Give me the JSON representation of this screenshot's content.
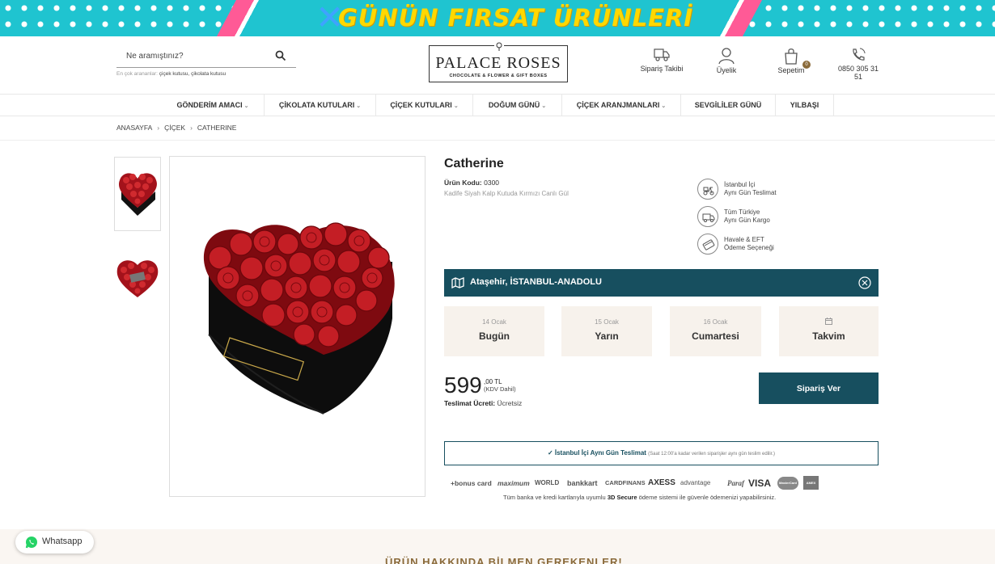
{
  "banner": {
    "title": "GÜNÜN FIRSAT ÜRÜNLERİ"
  },
  "search": {
    "placeholder": "Ne aramıştınız?",
    "popular_label": "En çok arananlar:",
    "popular_links": "çiçek kutusu, çikolata kutusu"
  },
  "logo": {
    "name": "PALACE ROSES",
    "tagline": "CHOCOLATE & FLOWER & GIFT BOXES"
  },
  "header": {
    "order_tracking": "Sipariş Takibi",
    "membership": "Üyelik",
    "cart": "Sepetim",
    "cart_count": "0",
    "phone": "0850 305 31 51"
  },
  "nav": [
    {
      "label": "GÖNDERİM AMACI",
      "has_dropdown": true
    },
    {
      "label": "ÇİKOLATA KUTULARI",
      "has_dropdown": true
    },
    {
      "label": "ÇİÇEK KUTULARI",
      "has_dropdown": true
    },
    {
      "label": "DOĞUM GÜNÜ",
      "has_dropdown": true
    },
    {
      "label": "ÇİÇEK ARANJMANLARI",
      "has_dropdown": true
    },
    {
      "label": "SEVGİLİLER GÜNÜ",
      "has_dropdown": false
    },
    {
      "label": "YILBAŞI",
      "has_dropdown": false
    }
  ],
  "breadcrumb": [
    "ANASAYFA",
    "ÇİÇEK",
    "CATHERINE"
  ],
  "product": {
    "title": "Catherine",
    "code_label": "Ürün Kodu:",
    "code": "0300",
    "description": "Kadife Siyah Kalp Kutuda Kırmızı Canlı Gül"
  },
  "features": [
    {
      "line1": "İstanbul İçi",
      "line2": "Aynı Gün Teslimat",
      "icon": "scooter-icon"
    },
    {
      "line1": "Tüm Türkiye",
      "line2": "Aynı Gün Kargo",
      "icon": "truck-icon"
    },
    {
      "line1": "Havale & EFT",
      "line2": "Ödeme Seçeneği",
      "icon": "card-icon"
    }
  ],
  "location": {
    "text": "Ataşehir, İSTANBUL-ANADOLU"
  },
  "delivery_days": [
    {
      "date": "14 Ocak",
      "day": "Bugün"
    },
    {
      "date": "15 Ocak",
      "day": "Yarın"
    },
    {
      "date": "16 Ocak",
      "day": "Cumartesi"
    },
    {
      "date": "",
      "day": "Takvim"
    }
  ],
  "price": {
    "integer": "599",
    "decimal": ",00 TL",
    "tax_note": "(KDV Dahil)",
    "shipping_label": "Teslimat Ücreti:",
    "shipping_value": "Ücretsiz"
  },
  "order_button": "Sipariş Ver",
  "delivery_note": {
    "check": "✓",
    "main": "İstanbul İçi Aynı Gün Teslimat",
    "sub": "(Saat 12:00'a kadar verilen siparişler aynı gün teslim edilir.)"
  },
  "payment_cards": [
    "+bonus card",
    "maximum",
    "WORLD",
    "bankkart",
    "CARDFINANS",
    "AXESS",
    "advantage",
    "Paraf",
    "VISA",
    "MasterCard",
    "AMEX"
  ],
  "secure_note": {
    "before": "Tüm banka ve kredi kartlarıyla uyumlu ",
    "bold": "3D Secure",
    "after": " ödeme sistemi ile güvenle ödemenizi yapabilirsiniz."
  },
  "bottom": {
    "heading": "ÜRÜN HAKKINDA BİLMEN GEREKENLER!"
  },
  "whatsapp": {
    "label": "Whatsapp"
  },
  "colors": {
    "primary": "#174f5f",
    "accent": "#8a6a3a",
    "banner": "#1fc4d0",
    "banner_text": "#ffd800",
    "card_bg": "#f7f2ec"
  }
}
